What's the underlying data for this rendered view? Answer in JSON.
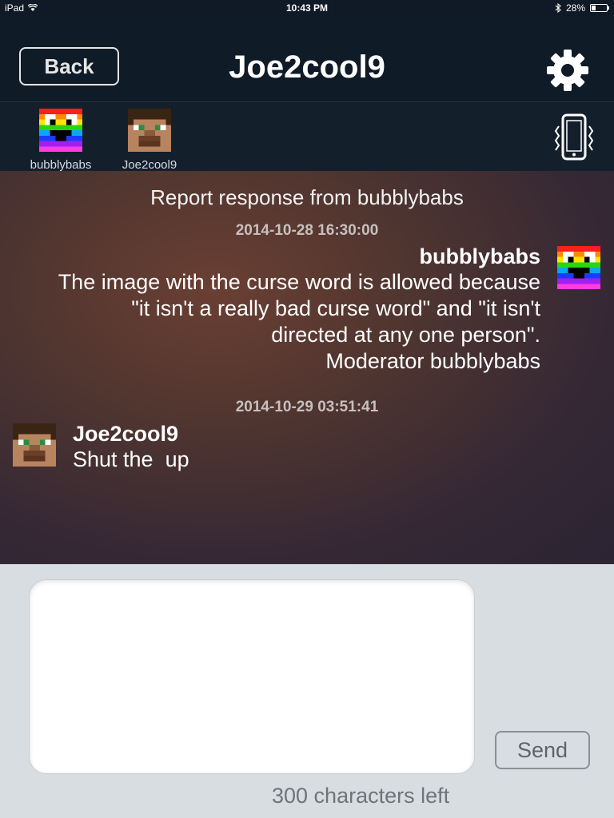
{
  "status_bar": {
    "device": "iPad",
    "time": "10:43 PM",
    "battery_text": "28%",
    "battery_level": 0.28
  },
  "nav": {
    "back_label": "Back",
    "title": "Joe2cool9",
    "settings_icon": "gear-icon"
  },
  "participants": [
    {
      "name": "bubblybabs",
      "avatar": "rainbow-face"
    },
    {
      "name": "Joe2cool9",
      "avatar": "steve-face"
    }
  ],
  "vibrate_icon": "phone-vibrate-icon",
  "chat": {
    "title": "Report response from bubblybabs",
    "messages": [
      {
        "timestamp": "2014-10-28 16:30:00",
        "sender": "bubblybabs",
        "side": "right",
        "lines": [
          "The image with the curse word is allowed because",
          "\"it isn't a really bad curse word\" and \"it isn't",
          "directed at any one person\".",
          "Moderator bubblybabs"
        ]
      },
      {
        "timestamp": "2014-10-29 03:51:41",
        "sender": "Joe2cool9",
        "side": "left",
        "lines": [
          "Shut the  up"
        ]
      }
    ]
  },
  "composer": {
    "text_value": "",
    "send_label": "Send",
    "counter_text": "300 characters left"
  },
  "colors": {
    "nav_bg": "#101b28",
    "composer_bg": "#d8dde2",
    "text_white": "#ffffff"
  }
}
